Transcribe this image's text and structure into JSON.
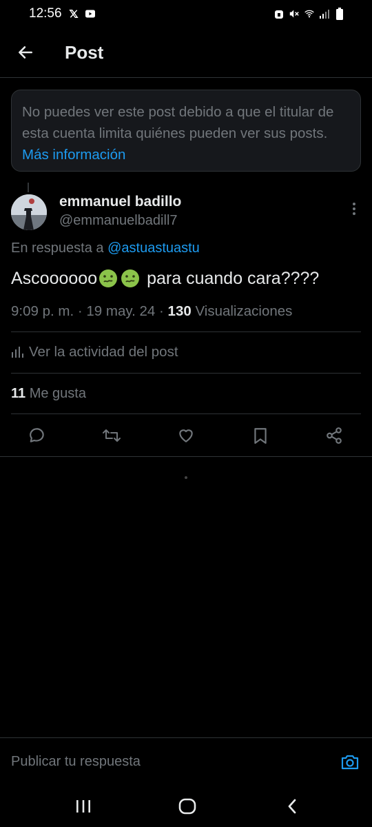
{
  "status_bar": {
    "time": "12:56"
  },
  "header": {
    "title": "Post"
  },
  "notice": {
    "text": "No puedes ver este post debido a que el titular de esta cuenta limita quiénes pueden ver sus posts.",
    "link": "Más información"
  },
  "post": {
    "author_name": "emmanuel badillo",
    "author_handle": "@emmanuelbadill7",
    "reply_prefix": "En respuesta a",
    "reply_mention": "@astuastuastu",
    "text_start": "Ascoooooo",
    "text_end": "para cuando cara????",
    "time": "9:09 p. m.",
    "date": "19 may. 24",
    "views_count": "130",
    "views_label": "Visualizaciones",
    "activity_label": "Ver la actividad del post",
    "likes_count": "11",
    "likes_label": "Me gusta"
  },
  "reply_bar": {
    "placeholder": "Publicar tu respuesta"
  },
  "colors": {
    "accent": "#1d9bf0",
    "muted": "#71767b",
    "text": "#e7e9ea",
    "border": "#2f3336"
  }
}
